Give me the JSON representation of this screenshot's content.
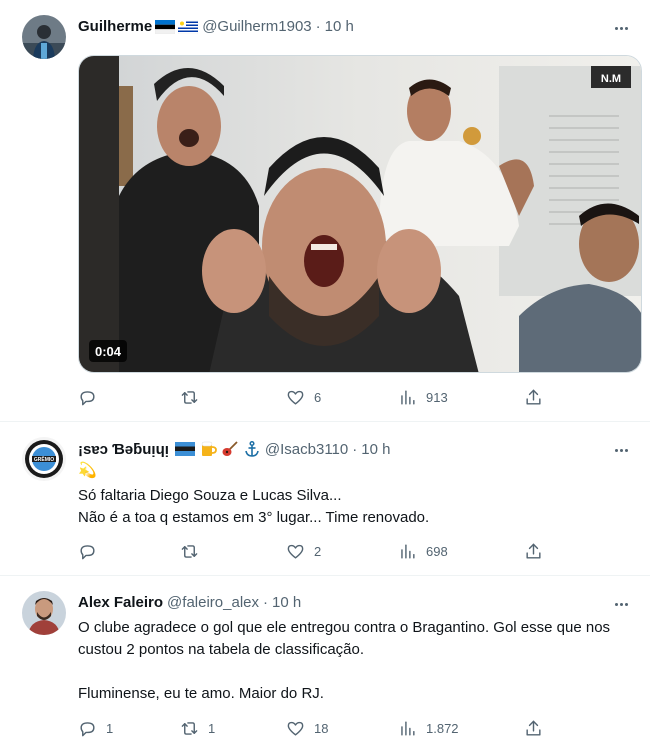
{
  "tweets": [
    {
      "name": "Guilherme",
      "handle": "@Guilherm1903",
      "time": "10 h",
      "video_duration": "0:04",
      "video_watermark": "N.M",
      "counts": {
        "reply": "",
        "retweet": "",
        "like": "6",
        "views": "913"
      },
      "colors": {
        "avatar": "#1a3a5c"
      }
    },
    {
      "name": "¡ѕɐɔ Ɓǝƃuᴉɥᴉ",
      "handle": "@Isacb3110",
      "time": "10 h",
      "emoji_line": "💫",
      "text": "Só faltaria Diego Souza e Lucas Silva...\nNão é a toa q estamos em 3° lugar... Time renovado.",
      "counts": {
        "reply": "",
        "retweet": "",
        "like": "2",
        "views": "698"
      }
    },
    {
      "name": "Alex Faleiro",
      "handle": "@faleiro_alex",
      "time": "10 h",
      "text": "O clube agradece o gol que ele entregou contra o Bragantino. Gol esse que nos custou 2 pontos na tabela de classificação.\n\nFluminense, eu te amo. Maior do RJ.",
      "counts": {
        "reply": "1",
        "retweet": "1",
        "like": "18",
        "views": "1.872"
      }
    }
  ],
  "icons": {
    "reply": "reply-icon",
    "retweet": "retweet-icon",
    "like": "heart-icon",
    "views": "views-icon",
    "share": "share-icon",
    "more": "more-icon"
  }
}
